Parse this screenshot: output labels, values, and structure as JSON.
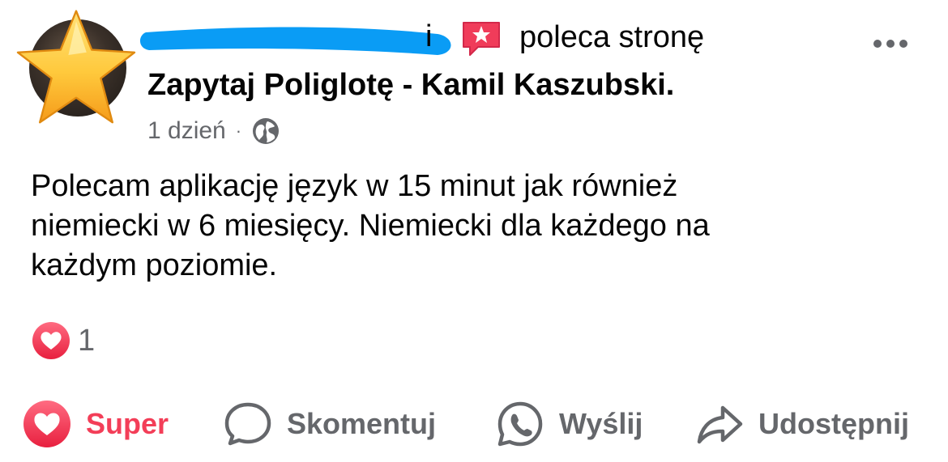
{
  "header": {
    "author_name_suffix": "i",
    "recommends_text": "poleca stronę",
    "page_name": "Zapytaj Poliglotę - Kamil Kaszubski.",
    "timestamp": "1 dzień",
    "separator": "·",
    "privacy_icon": "globe-icon",
    "menu_icon": "more-horizontal-icon"
  },
  "post": {
    "text": "Polecam aplikację język w 15 minut jak również\nniemiecki w 6 miesięcy. Niemiecki dla każdego na\nkażdym poziomie."
  },
  "reactions": {
    "icon": "heart-reaction-icon",
    "count": "1"
  },
  "actions": [
    {
      "label": "Super",
      "icon": "heart-filled-icon",
      "active": true
    },
    {
      "label": "Skomentuj",
      "icon": "comment-bubble-icon"
    },
    {
      "label": "Wyślij",
      "icon": "whatsapp-icon"
    },
    {
      "label": "Udostępnij",
      "icon": "share-arrow-icon"
    }
  ],
  "colors": {
    "redaction_blue": "#0a9cf5",
    "super_red": "#f33e58",
    "secondary_text": "#65676b",
    "star_gold": "#ffc93c"
  }
}
